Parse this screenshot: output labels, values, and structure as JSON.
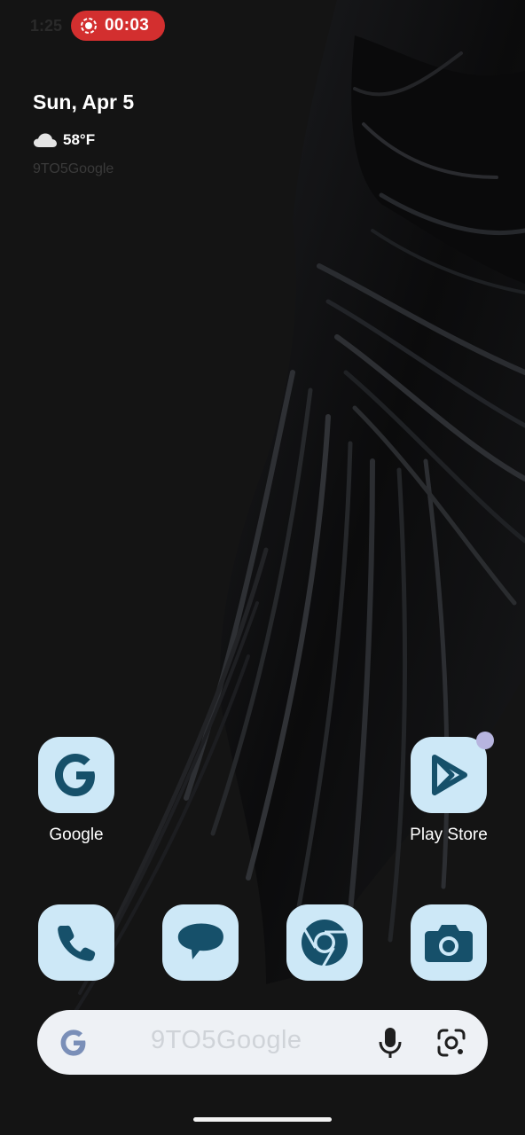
{
  "status_bar": {
    "time": "1:25",
    "recording_time": "00:03",
    "recording_color": "#d32f2f"
  },
  "at_a_glance": {
    "date": "Sun, Apr 5",
    "weather_icon": "cloud-icon",
    "temperature": "58°F",
    "watermark": "9TO5Google"
  },
  "apps": {
    "row1": [
      {
        "label": "Google",
        "icon": "google-g-icon"
      },
      {
        "label": "Play Store",
        "icon": "play-store-icon",
        "has_notification_dot": true
      }
    ],
    "dock": [
      {
        "label": "Phone",
        "icon": "phone-icon"
      },
      {
        "label": "Messages",
        "icon": "messages-icon"
      },
      {
        "label": "Chrome",
        "icon": "chrome-icon"
      },
      {
        "label": "Camera",
        "icon": "camera-icon"
      }
    ]
  },
  "search_bar": {
    "placeholder_watermark": "9TO5Google",
    "left_icon": "google-g-icon",
    "mic_icon": "mic-icon",
    "lens_icon": "lens-icon"
  },
  "colors": {
    "icon_background": "#cde8f7",
    "icon_glyph": "#16506a",
    "search_bar": "#eef1f5",
    "notification_dot": "#b7b5df"
  }
}
